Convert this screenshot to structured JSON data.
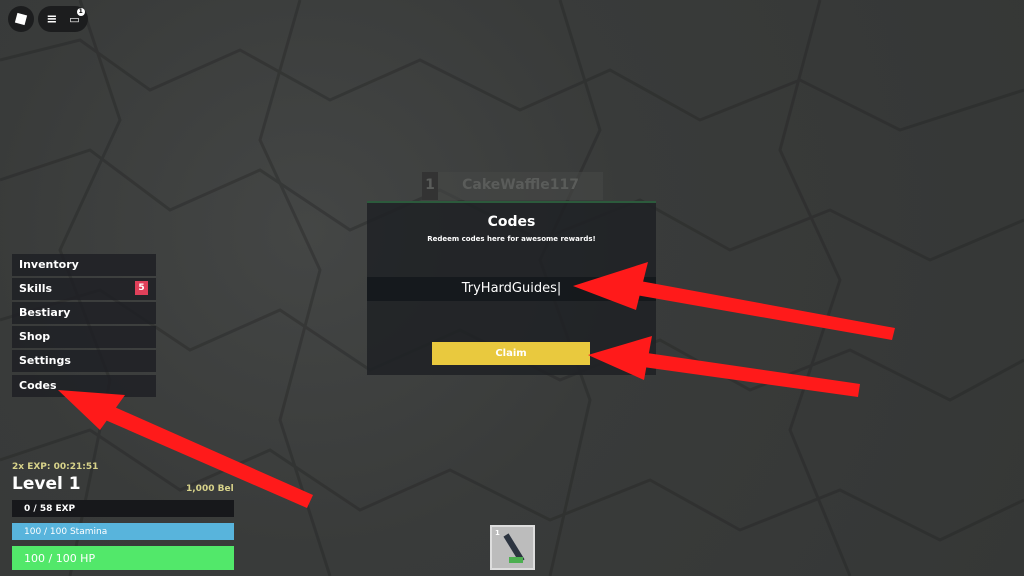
{
  "topbar": {
    "roblox_icon": "roblox-logo-icon",
    "menu_icon": "hamburger-icon",
    "chat_icon": "chat-icon",
    "chat_badge": "1"
  },
  "leaderboard": {
    "rank": "1",
    "player": "CakeWaffle117"
  },
  "codes_dialog": {
    "title": "Codes",
    "subtitle": "Redeem codes here for awesome rewards!",
    "input_value": "TryHardGuides",
    "claim_label": "Claim",
    "accent": "#e9c93e"
  },
  "menu": {
    "items": [
      {
        "label": "Inventory"
      },
      {
        "label": "Skills",
        "badge": "5"
      },
      {
        "label": "Bestiary"
      },
      {
        "label": "Shop"
      },
      {
        "label": "Settings"
      },
      {
        "label": "Codes"
      }
    ]
  },
  "stats": {
    "boost": "2x EXP: 00:21:51",
    "level": "Level 1",
    "currency": "1,000 Bel",
    "exp": "0 / 58 EXP",
    "stamina": "100 / 100 Stamina",
    "hp": "100 / 100 HP",
    "exp_fraction": 0,
    "stamina_fraction": 1,
    "hp_fraction": 1
  },
  "hotbar": {
    "slot_key": "1",
    "item_icon": "sword-icon"
  },
  "annotation_color": "#ff1a1a"
}
